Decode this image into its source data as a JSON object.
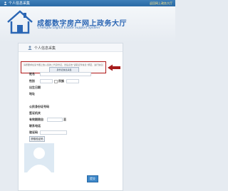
{
  "topbar": {
    "title": "个人信息采集",
    "link": "返回网上政务大厅"
  },
  "header": {
    "logo_title": "成都数字房产网上政务大厅",
    "logo_subtitle": "Chengdu Digital Estate Support System"
  },
  "panel": {
    "title": "个人信息采集",
    "notice": {
      "message": "请按要求在读卡器上放入您的二代身份证，然后点击“读取证件信息”按钮，进行信息采集",
      "button_label": "身份证信息采集"
    },
    "form": {
      "name_label": "姓名",
      "gender_label": "性别",
      "ethnicity_label": "民族",
      "birthdate_label": "出生日期",
      "address_label": "地址",
      "id_number_label": "公民身份证号码",
      "issuer_label": "签证机关",
      "validity_label": "有效期限自",
      "validity_to_label": "至",
      "contact_phone_label": "联系电话",
      "verify_code_label": "验证码",
      "read_card_label": "获取验证码"
    }
  },
  "footer": {
    "next_label": "提交"
  },
  "colors": {
    "brand_blue": "#2b66b4",
    "topbar": "#3f7fb8",
    "highlight_red": "#b01818"
  }
}
